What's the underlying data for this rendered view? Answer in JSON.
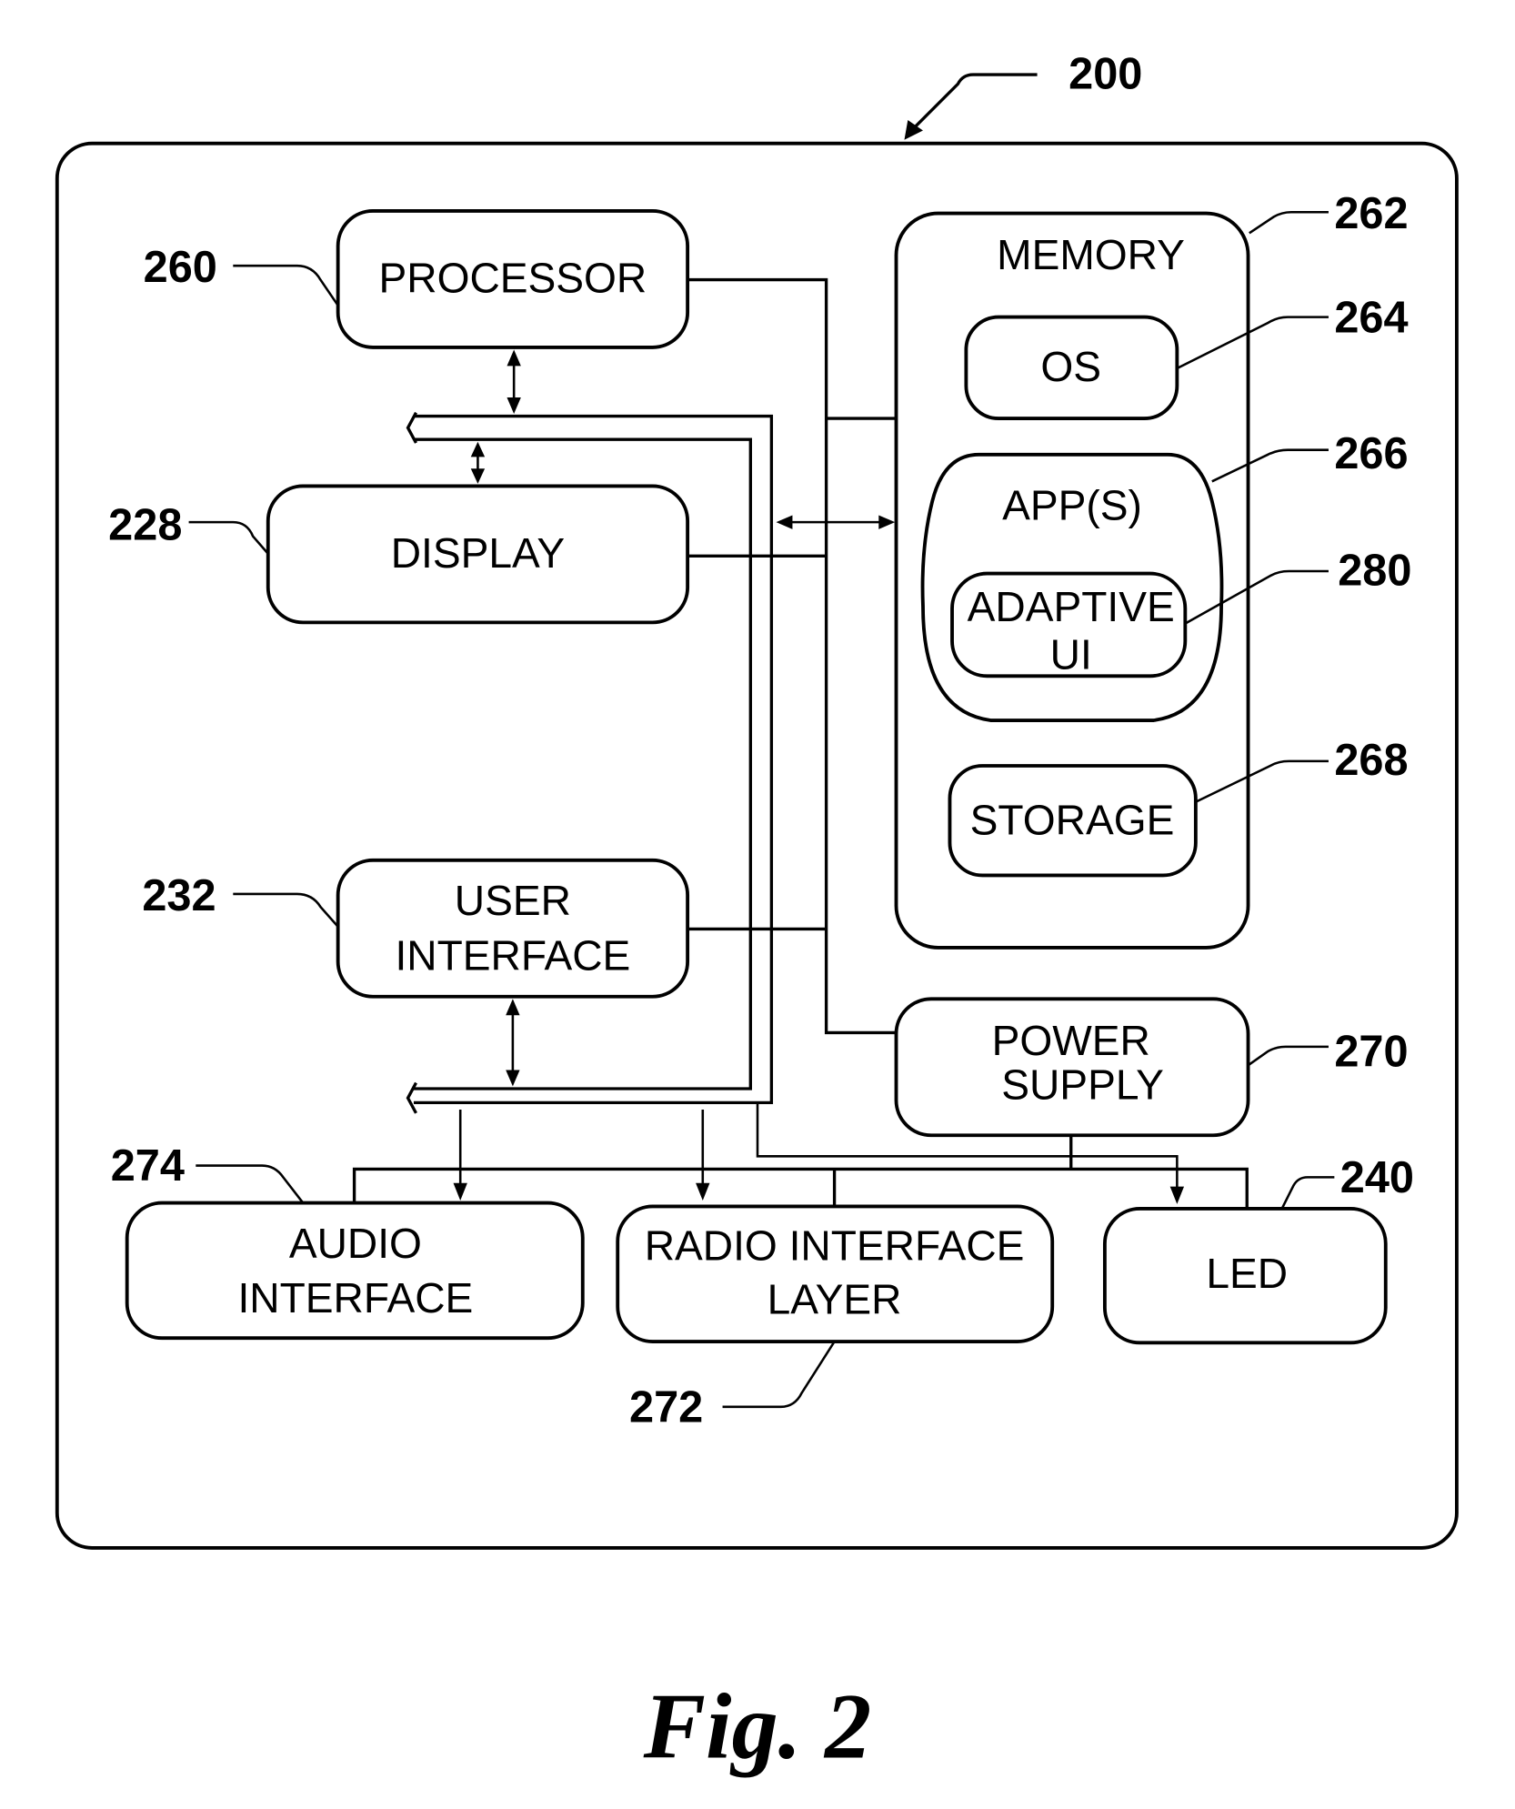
{
  "figure": {
    "caption": "Fig. 2",
    "device_ref": "200"
  },
  "blocks": {
    "processor": {
      "label": "PROCESSOR",
      "ref": "260"
    },
    "display": {
      "label": "DISPLAY",
      "ref": "228"
    },
    "user_interface": {
      "label_line1": "USER",
      "label_line2": "INTERFACE",
      "ref": "232"
    },
    "memory": {
      "label": "MEMORY",
      "ref": "262"
    },
    "os": {
      "label": "OS",
      "ref": "264"
    },
    "apps": {
      "label": "APP(S)",
      "ref": "266"
    },
    "adaptive_ui": {
      "label_line1": "ADAPTIVE",
      "label_line2": "UI",
      "ref": "280"
    },
    "storage": {
      "label": "STORAGE",
      "ref": "268"
    },
    "power_supply": {
      "label_line1": "POWER",
      "label_line2": "SUPPLY",
      "ref": "270"
    },
    "audio_interface": {
      "label_line1": "AUDIO",
      "label_line2": "INTERFACE",
      "ref": "274"
    },
    "radio_interface_layer": {
      "label_line1": "RADIO INTERFACE",
      "label_line2": "LAYER",
      "ref": "272"
    },
    "led": {
      "label": "LED",
      "ref": "240"
    }
  }
}
